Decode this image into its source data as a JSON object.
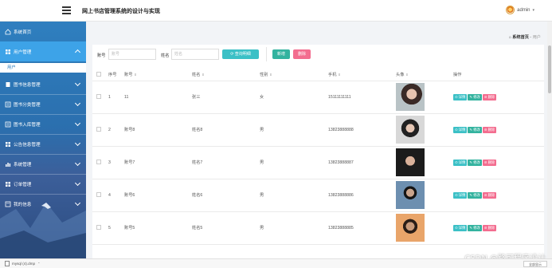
{
  "header": {
    "title": "网上书店管理系统的设计与实现",
    "user": "admin"
  },
  "sidebar": {
    "items": [
      {
        "label": "系统首页",
        "icon": "home-icon"
      },
      {
        "label": "用户管理",
        "icon": "grid-icon"
      },
      {
        "label": "图书信息管理",
        "icon": "book-icon"
      },
      {
        "label": "图书分类管理",
        "icon": "list-icon"
      },
      {
        "label": "图书入库管理",
        "icon": "list-icon"
      },
      {
        "label": "公告信息管理",
        "icon": "grid-icon"
      },
      {
        "label": "系统管理",
        "icon": "chart-icon"
      },
      {
        "label": "订单管理",
        "icon": "grid-icon"
      },
      {
        "label": "我的信息",
        "icon": "doc-icon"
      }
    ],
    "sub_item": "用户"
  },
  "breadcrumb": {
    "home": "系统首页",
    "sep": "-",
    "current": "用户"
  },
  "search": {
    "account_label": "账号",
    "account_placeholder": "账号",
    "name_label": "姓名",
    "name_placeholder": "姓名",
    "query_button": "查询明细",
    "add_button": "新增",
    "delete_button": "删除"
  },
  "table": {
    "headers": [
      "序号",
      "账号",
      "姓名",
      "性别",
      "手机",
      "头像",
      "操作"
    ],
    "rows": [
      {
        "index": "1",
        "account": "11",
        "name": "张三",
        "gender": "女",
        "phone": "15111111111",
        "photo": "photo-woman-1"
      },
      {
        "index": "2",
        "account": "账号8",
        "name": "姓名8",
        "gender": "男",
        "phone": "13823888888",
        "photo": "photo-woman-2"
      },
      {
        "index": "3",
        "account": "账号7",
        "name": "姓名7",
        "gender": "男",
        "phone": "13823888887",
        "photo": "photo-man-1"
      },
      {
        "index": "4",
        "account": "账号6",
        "name": "姓名6",
        "gender": "男",
        "phone": "13823888886",
        "photo": "photo-man-2"
      },
      {
        "index": "5",
        "account": "账号5",
        "name": "姓名5",
        "gender": "男",
        "phone": "13823888885",
        "photo": "photo-man-3"
      }
    ],
    "ops": {
      "detail": "详情",
      "edit": "修改",
      "remove": "删除"
    }
  },
  "statusbar": {
    "download_file": "mysql (4).dmp",
    "show_all": "全部显示"
  },
  "watermark": "CSDN @路可程序设计",
  "colors": {
    "sidebar": "#2f7fbf",
    "active": "#3da3e8",
    "teal": "#3bc0c6",
    "green": "#33b39f",
    "pink": "#f36d8f"
  }
}
